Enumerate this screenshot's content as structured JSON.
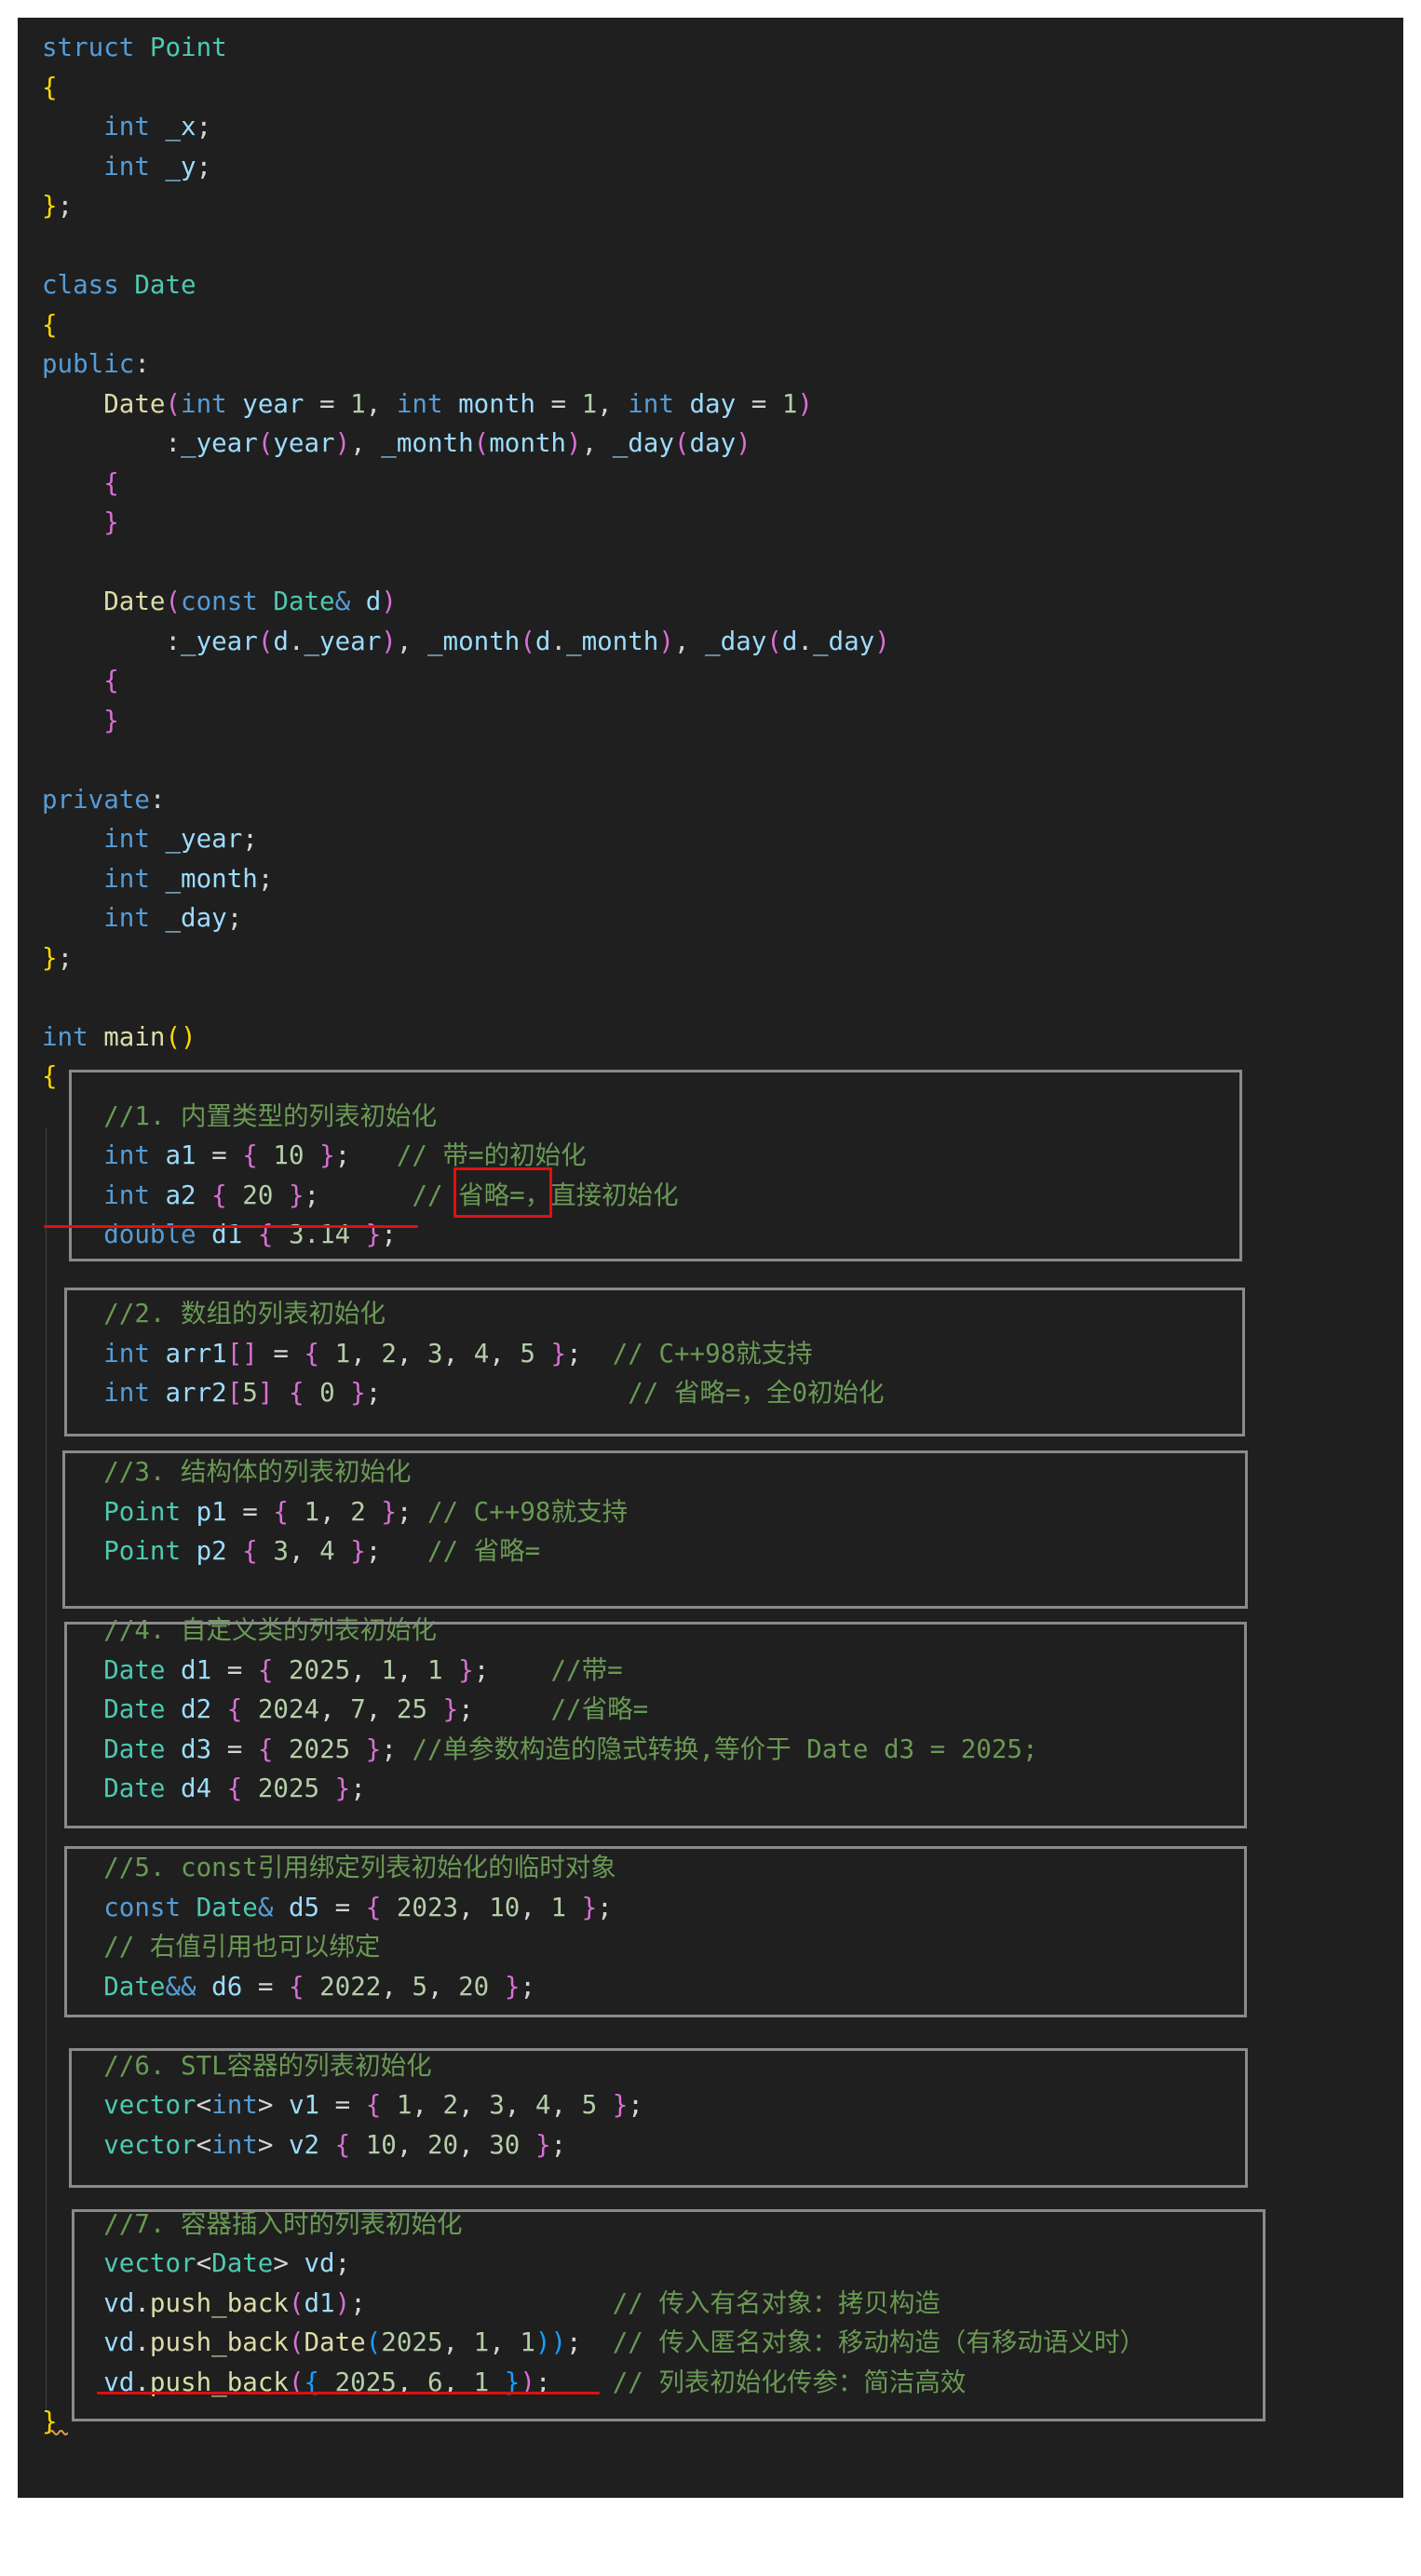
{
  "theme": {
    "background": "#1f1f1f",
    "keyword": "#569cd6",
    "type": "#4ec9b0",
    "function": "#dcdcaa",
    "variable": "#9cdcfe",
    "number": "#b5cea8",
    "comment": "#6a9955",
    "bracket_level1": "#ffd700",
    "bracket_level2": "#da70d6",
    "bracket_level3": "#179fff",
    "box_outline": "#8a8a8a",
    "annotation_red": "#e01010"
  },
  "code_lines": [
    [
      [
        "kw",
        "struct"
      ],
      [
        "pn",
        " "
      ],
      [
        "ty",
        "Point"
      ]
    ],
    [
      [
        "b1",
        "{"
      ]
    ],
    [
      [
        "pn",
        "    "
      ],
      [
        "kw",
        "int"
      ],
      [
        "pn",
        " "
      ],
      [
        "vr",
        "_x"
      ],
      [
        "pn",
        ";"
      ]
    ],
    [
      [
        "pn",
        "    "
      ],
      [
        "kw",
        "int"
      ],
      [
        "pn",
        " "
      ],
      [
        "vr",
        "_y"
      ],
      [
        "pn",
        ";"
      ]
    ],
    [
      [
        "b1",
        "}"
      ],
      [
        "pn",
        ";"
      ]
    ],
    [],
    [
      [
        "kw",
        "class"
      ],
      [
        "pn",
        " "
      ],
      [
        "ty",
        "Date"
      ]
    ],
    [
      [
        "b1",
        "{"
      ]
    ],
    [
      [
        "kw",
        "public"
      ],
      [
        "pn",
        ":"
      ]
    ],
    [
      [
        "pn",
        "    "
      ],
      [
        "fn",
        "Date"
      ],
      [
        "b2",
        "("
      ],
      [
        "kw",
        "int"
      ],
      [
        "pn",
        " "
      ],
      [
        "vr",
        "year"
      ],
      [
        "pn",
        " = "
      ],
      [
        "nm",
        "1"
      ],
      [
        "pn",
        ", "
      ],
      [
        "kw",
        "int"
      ],
      [
        "pn",
        " "
      ],
      [
        "vr",
        "month"
      ],
      [
        "pn",
        " = "
      ],
      [
        "nm",
        "1"
      ],
      [
        "pn",
        ", "
      ],
      [
        "kw",
        "int"
      ],
      [
        "pn",
        " "
      ],
      [
        "vr",
        "day"
      ],
      [
        "pn",
        " = "
      ],
      [
        "nm",
        "1"
      ],
      [
        "b2",
        ")"
      ]
    ],
    [
      [
        "pn",
        "        :"
      ],
      [
        "vr",
        "_year"
      ],
      [
        "b2",
        "("
      ],
      [
        "vr",
        "year"
      ],
      [
        "b2",
        ")"
      ],
      [
        "pn",
        ", "
      ],
      [
        "vr",
        "_month"
      ],
      [
        "b2",
        "("
      ],
      [
        "vr",
        "month"
      ],
      [
        "b2",
        ")"
      ],
      [
        "pn",
        ", "
      ],
      [
        "vr",
        "_day"
      ],
      [
        "b2",
        "("
      ],
      [
        "vr",
        "day"
      ],
      [
        "b2",
        ")"
      ]
    ],
    [
      [
        "pn",
        "    "
      ],
      [
        "b2",
        "{"
      ]
    ],
    [
      [
        "pn",
        "    "
      ],
      [
        "b2",
        "}"
      ]
    ],
    [],
    [
      [
        "pn",
        "    "
      ],
      [
        "fn",
        "Date"
      ],
      [
        "b2",
        "("
      ],
      [
        "kw",
        "const"
      ],
      [
        "pn",
        " "
      ],
      [
        "ty",
        "Date"
      ],
      [
        "kw",
        "&"
      ],
      [
        "pn",
        " "
      ],
      [
        "vr",
        "d"
      ],
      [
        "b2",
        ")"
      ]
    ],
    [
      [
        "pn",
        "        :"
      ],
      [
        "vr",
        "_year"
      ],
      [
        "b2",
        "("
      ],
      [
        "vr",
        "d"
      ],
      [
        "pn",
        "."
      ],
      [
        "vr",
        "_year"
      ],
      [
        "b2",
        ")"
      ],
      [
        "pn",
        ", "
      ],
      [
        "vr",
        "_month"
      ],
      [
        "b2",
        "("
      ],
      [
        "vr",
        "d"
      ],
      [
        "pn",
        "."
      ],
      [
        "vr",
        "_month"
      ],
      [
        "b2",
        ")"
      ],
      [
        "pn",
        ", "
      ],
      [
        "vr",
        "_day"
      ],
      [
        "b2",
        "("
      ],
      [
        "vr",
        "d"
      ],
      [
        "pn",
        "."
      ],
      [
        "vr",
        "_day"
      ],
      [
        "b2",
        ")"
      ]
    ],
    [
      [
        "pn",
        "    "
      ],
      [
        "b2",
        "{"
      ]
    ],
    [
      [
        "pn",
        "    "
      ],
      [
        "b2",
        "}"
      ]
    ],
    [],
    [
      [
        "kw",
        "private"
      ],
      [
        "pn",
        ":"
      ]
    ],
    [
      [
        "pn",
        "    "
      ],
      [
        "kw",
        "int"
      ],
      [
        "pn",
        " "
      ],
      [
        "vr",
        "_year"
      ],
      [
        "pn",
        ";"
      ]
    ],
    [
      [
        "pn",
        "    "
      ],
      [
        "kw",
        "int"
      ],
      [
        "pn",
        " "
      ],
      [
        "vr",
        "_month"
      ],
      [
        "pn",
        ";"
      ]
    ],
    [
      [
        "pn",
        "    "
      ],
      [
        "kw",
        "int"
      ],
      [
        "pn",
        " "
      ],
      [
        "vr",
        "_day"
      ],
      [
        "pn",
        ";"
      ]
    ],
    [
      [
        "b1",
        "}"
      ],
      [
        "pn",
        ";"
      ]
    ],
    [],
    [
      [
        "kw",
        "int"
      ],
      [
        "pn",
        " "
      ],
      [
        "fn",
        "main"
      ],
      [
        "b1",
        "()"
      ]
    ],
    [
      [
        "b1",
        "{"
      ]
    ],
    [
      [
        "pn",
        "    "
      ],
      [
        "cm",
        "//1. 内置类型的列表初始化"
      ]
    ],
    [
      [
        "pn",
        "    "
      ],
      [
        "kw",
        "int"
      ],
      [
        "pn",
        " "
      ],
      [
        "vr",
        "a1"
      ],
      [
        "pn",
        " = "
      ],
      [
        "b2",
        "{"
      ],
      [
        "pn",
        " "
      ],
      [
        "nm",
        "10"
      ],
      [
        "pn",
        " "
      ],
      [
        "b2",
        "}"
      ],
      [
        "pn",
        ";   "
      ],
      [
        "cm",
        "// 带=的初始化"
      ]
    ],
    [
      [
        "pn",
        "    "
      ],
      [
        "kw",
        "int"
      ],
      [
        "pn",
        " "
      ],
      [
        "vr",
        "a2"
      ],
      [
        "pn",
        " "
      ],
      [
        "b2",
        "{"
      ],
      [
        "pn",
        " "
      ],
      [
        "nm",
        "20"
      ],
      [
        "pn",
        " "
      ],
      [
        "b2",
        "}"
      ],
      [
        "pn",
        ";      "
      ],
      [
        "cm",
        "// 省略=，直接初始化"
      ]
    ],
    [
      [
        "pn",
        "    "
      ],
      [
        "kw",
        "double"
      ],
      [
        "pn",
        " "
      ],
      [
        "vr",
        "d1"
      ],
      [
        "pn",
        " "
      ],
      [
        "b2",
        "{"
      ],
      [
        "pn",
        " "
      ],
      [
        "nm",
        "3.14"
      ],
      [
        "pn",
        " "
      ],
      [
        "b2",
        "}"
      ],
      [
        "pn",
        ";"
      ]
    ],
    [],
    [
      [
        "pn",
        "    "
      ],
      [
        "cm",
        "//2. 数组的列表初始化"
      ]
    ],
    [
      [
        "pn",
        "    "
      ],
      [
        "kw",
        "int"
      ],
      [
        "pn",
        " "
      ],
      [
        "vr",
        "arr1"
      ],
      [
        "b2",
        "[]"
      ],
      [
        "pn",
        " = "
      ],
      [
        "b2",
        "{"
      ],
      [
        "pn",
        " "
      ],
      [
        "nm",
        "1"
      ],
      [
        "pn",
        ", "
      ],
      [
        "nm",
        "2"
      ],
      [
        "pn",
        ", "
      ],
      [
        "nm",
        "3"
      ],
      [
        "pn",
        ", "
      ],
      [
        "nm",
        "4"
      ],
      [
        "pn",
        ", "
      ],
      [
        "nm",
        "5"
      ],
      [
        "pn",
        " "
      ],
      [
        "b2",
        "}"
      ],
      [
        "pn",
        ";  "
      ],
      [
        "cm",
        "// C++98就支持"
      ]
    ],
    [
      [
        "pn",
        "    "
      ],
      [
        "kw",
        "int"
      ],
      [
        "pn",
        " "
      ],
      [
        "vr",
        "arr2"
      ],
      [
        "b2",
        "["
      ],
      [
        "nm",
        "5"
      ],
      [
        "b2",
        "]"
      ],
      [
        "pn",
        " "
      ],
      [
        "b2",
        "{"
      ],
      [
        "pn",
        " "
      ],
      [
        "nm",
        "0"
      ],
      [
        "pn",
        " "
      ],
      [
        "b2",
        "}"
      ],
      [
        "pn",
        ";                "
      ],
      [
        "cm",
        "// 省略=，全0初始化"
      ]
    ],
    [],
    [
      [
        "pn",
        "    "
      ],
      [
        "cm",
        "//3. 结构体的列表初始化"
      ]
    ],
    [
      [
        "pn",
        "    "
      ],
      [
        "ty",
        "Point"
      ],
      [
        "pn",
        " "
      ],
      [
        "vr",
        "p1"
      ],
      [
        "pn",
        " = "
      ],
      [
        "b2",
        "{"
      ],
      [
        "pn",
        " "
      ],
      [
        "nm",
        "1"
      ],
      [
        "pn",
        ", "
      ],
      [
        "nm",
        "2"
      ],
      [
        "pn",
        " "
      ],
      [
        "b2",
        "}"
      ],
      [
        "pn",
        "; "
      ],
      [
        "cm",
        "// C++98就支持"
      ]
    ],
    [
      [
        "pn",
        "    "
      ],
      [
        "ty",
        "Point"
      ],
      [
        "pn",
        " "
      ],
      [
        "vr",
        "p2"
      ],
      [
        "pn",
        " "
      ],
      [
        "b2",
        "{"
      ],
      [
        "pn",
        " "
      ],
      [
        "nm",
        "3"
      ],
      [
        "pn",
        ", "
      ],
      [
        "nm",
        "4"
      ],
      [
        "pn",
        " "
      ],
      [
        "b2",
        "}"
      ],
      [
        "pn",
        ";   "
      ],
      [
        "cm",
        "// 省略="
      ]
    ],
    [],
    [
      [
        "pn",
        "    "
      ],
      [
        "cm",
        "//4. 自定义类的列表初始化"
      ]
    ],
    [
      [
        "pn",
        "    "
      ],
      [
        "ty",
        "Date"
      ],
      [
        "pn",
        " "
      ],
      [
        "vr",
        "d1"
      ],
      [
        "pn",
        " = "
      ],
      [
        "b2",
        "{"
      ],
      [
        "pn",
        " "
      ],
      [
        "nm",
        "2025"
      ],
      [
        "pn",
        ", "
      ],
      [
        "nm",
        "1"
      ],
      [
        "pn",
        ", "
      ],
      [
        "nm",
        "1"
      ],
      [
        "pn",
        " "
      ],
      [
        "b2",
        "}"
      ],
      [
        "pn",
        ";    "
      ],
      [
        "cm",
        "//带="
      ]
    ],
    [
      [
        "pn",
        "    "
      ],
      [
        "ty",
        "Date"
      ],
      [
        "pn",
        " "
      ],
      [
        "vr",
        "d2"
      ],
      [
        "pn",
        " "
      ],
      [
        "b2",
        "{"
      ],
      [
        "pn",
        " "
      ],
      [
        "nm",
        "2024"
      ],
      [
        "pn",
        ", "
      ],
      [
        "nm",
        "7"
      ],
      [
        "pn",
        ", "
      ],
      [
        "nm",
        "25"
      ],
      [
        "pn",
        " "
      ],
      [
        "b2",
        "}"
      ],
      [
        "pn",
        ";     "
      ],
      [
        "cm",
        "//省略="
      ]
    ],
    [
      [
        "pn",
        "    "
      ],
      [
        "ty",
        "Date"
      ],
      [
        "pn",
        " "
      ],
      [
        "vr",
        "d3"
      ],
      [
        "pn",
        " = "
      ],
      [
        "b2",
        "{"
      ],
      [
        "pn",
        " "
      ],
      [
        "nm",
        "2025"
      ],
      [
        "pn",
        " "
      ],
      [
        "b2",
        "}"
      ],
      [
        "pn",
        "; "
      ],
      [
        "cm",
        "//单参数构造的隐式转换,等价于 Date d3 = 2025;"
      ]
    ],
    [
      [
        "pn",
        "    "
      ],
      [
        "ty",
        "Date"
      ],
      [
        "pn",
        " "
      ],
      [
        "vr",
        "d4"
      ],
      [
        "pn",
        " "
      ],
      [
        "b2",
        "{"
      ],
      [
        "pn",
        " "
      ],
      [
        "nm",
        "2025"
      ],
      [
        "pn",
        " "
      ],
      [
        "b2",
        "}"
      ],
      [
        "pn",
        ";"
      ]
    ],
    [],
    [
      [
        "pn",
        "    "
      ],
      [
        "cm",
        "//5. const引用绑定列表初始化的临时对象"
      ]
    ],
    [
      [
        "pn",
        "    "
      ],
      [
        "kw",
        "const"
      ],
      [
        "pn",
        " "
      ],
      [
        "ty",
        "Date"
      ],
      [
        "kw",
        "&"
      ],
      [
        "pn",
        " "
      ],
      [
        "vr",
        "d5"
      ],
      [
        "pn",
        " = "
      ],
      [
        "b2",
        "{"
      ],
      [
        "pn",
        " "
      ],
      [
        "nm",
        "2023"
      ],
      [
        "pn",
        ", "
      ],
      [
        "nm",
        "10"
      ],
      [
        "pn",
        ", "
      ],
      [
        "nm",
        "1"
      ],
      [
        "pn",
        " "
      ],
      [
        "b2",
        "}"
      ],
      [
        "pn",
        ";"
      ]
    ],
    [
      [
        "pn",
        "    "
      ],
      [
        "cm",
        "// 右值引用也可以绑定"
      ]
    ],
    [
      [
        "pn",
        "    "
      ],
      [
        "ty",
        "Date"
      ],
      [
        "kw",
        "&&"
      ],
      [
        "pn",
        " "
      ],
      [
        "vr",
        "d6"
      ],
      [
        "pn",
        " = "
      ],
      [
        "b2",
        "{"
      ],
      [
        "pn",
        " "
      ],
      [
        "nm",
        "2022"
      ],
      [
        "pn",
        ", "
      ],
      [
        "nm",
        "5"
      ],
      [
        "pn",
        ", "
      ],
      [
        "nm",
        "20"
      ],
      [
        "pn",
        " "
      ],
      [
        "b2",
        "}"
      ],
      [
        "pn",
        ";"
      ]
    ],
    [],
    [
      [
        "pn",
        "    "
      ],
      [
        "cm",
        "//6. STL容器的列表初始化"
      ]
    ],
    [
      [
        "pn",
        "    "
      ],
      [
        "ty",
        "vector"
      ],
      [
        "pn",
        "<"
      ],
      [
        "kw",
        "int"
      ],
      [
        "pn",
        "> "
      ],
      [
        "vr",
        "v1"
      ],
      [
        "pn",
        " = "
      ],
      [
        "b2",
        "{"
      ],
      [
        "pn",
        " "
      ],
      [
        "nm",
        "1"
      ],
      [
        "pn",
        ", "
      ],
      [
        "nm",
        "2"
      ],
      [
        "pn",
        ", "
      ],
      [
        "nm",
        "3"
      ],
      [
        "pn",
        ", "
      ],
      [
        "nm",
        "4"
      ],
      [
        "pn",
        ", "
      ],
      [
        "nm",
        "5"
      ],
      [
        "pn",
        " "
      ],
      [
        "b2",
        "}"
      ],
      [
        "pn",
        ";"
      ]
    ],
    [
      [
        "pn",
        "    "
      ],
      [
        "ty",
        "vector"
      ],
      [
        "pn",
        "<"
      ],
      [
        "kw",
        "int"
      ],
      [
        "pn",
        "> "
      ],
      [
        "vr",
        "v2"
      ],
      [
        "pn",
        " "
      ],
      [
        "b2",
        "{"
      ],
      [
        "pn",
        " "
      ],
      [
        "nm",
        "10"
      ],
      [
        "pn",
        ", "
      ],
      [
        "nm",
        "20"
      ],
      [
        "pn",
        ", "
      ],
      [
        "nm",
        "30"
      ],
      [
        "pn",
        " "
      ],
      [
        "b2",
        "}"
      ],
      [
        "pn",
        ";"
      ]
    ],
    [],
    [
      [
        "pn",
        "    "
      ],
      [
        "cm",
        "//7. 容器插入时的列表初始化"
      ]
    ],
    [
      [
        "pn",
        "    "
      ],
      [
        "ty",
        "vector"
      ],
      [
        "pn",
        "<"
      ],
      [
        "ty",
        "Date"
      ],
      [
        "pn",
        "> "
      ],
      [
        "vr",
        "vd"
      ],
      [
        "pn",
        ";"
      ]
    ],
    [
      [
        "pn",
        "    "
      ],
      [
        "vr",
        "vd"
      ],
      [
        "pn",
        "."
      ],
      [
        "fn",
        "push_back"
      ],
      [
        "b2",
        "("
      ],
      [
        "vr",
        "d1"
      ],
      [
        "b2",
        ")"
      ],
      [
        "pn",
        ";                "
      ],
      [
        "cm",
        "// 传入有名对象：拷贝构造"
      ]
    ],
    [
      [
        "pn",
        "    "
      ],
      [
        "vr",
        "vd"
      ],
      [
        "pn",
        "."
      ],
      [
        "fn",
        "push_back"
      ],
      [
        "b2",
        "("
      ],
      [
        "fn",
        "Date"
      ],
      [
        "b3",
        "("
      ],
      [
        "nm",
        "2025"
      ],
      [
        "pn",
        ", "
      ],
      [
        "nm",
        "1"
      ],
      [
        "pn",
        ", "
      ],
      [
        "nm",
        "1"
      ],
      [
        "b3",
        "))"
      ],
      [
        "pn",
        ";  "
      ],
      [
        "cm",
        "// 传入匿名对象：移动构造（有移动语义时）"
      ]
    ],
    [
      [
        "pn",
        "    "
      ],
      [
        "vr",
        "vd"
      ],
      [
        "pn",
        "."
      ],
      [
        "fn",
        "push_back"
      ],
      [
        "b2",
        "("
      ],
      [
        "b3",
        "{"
      ],
      [
        "pn",
        " "
      ],
      [
        "nm",
        "2025"
      ],
      [
        "pn",
        ", "
      ],
      [
        "nm",
        "6"
      ],
      [
        "pn",
        ", "
      ],
      [
        "nm",
        "1"
      ],
      [
        "pn",
        " "
      ],
      [
        "b3",
        "}"
      ],
      [
        "b2",
        ")"
      ],
      [
        "pn",
        ";    "
      ],
      [
        "cm",
        "// 列表初始化传参：简洁高效"
      ]
    ],
    [
      [
        "b1",
        "}"
      ]
    ]
  ]
}
